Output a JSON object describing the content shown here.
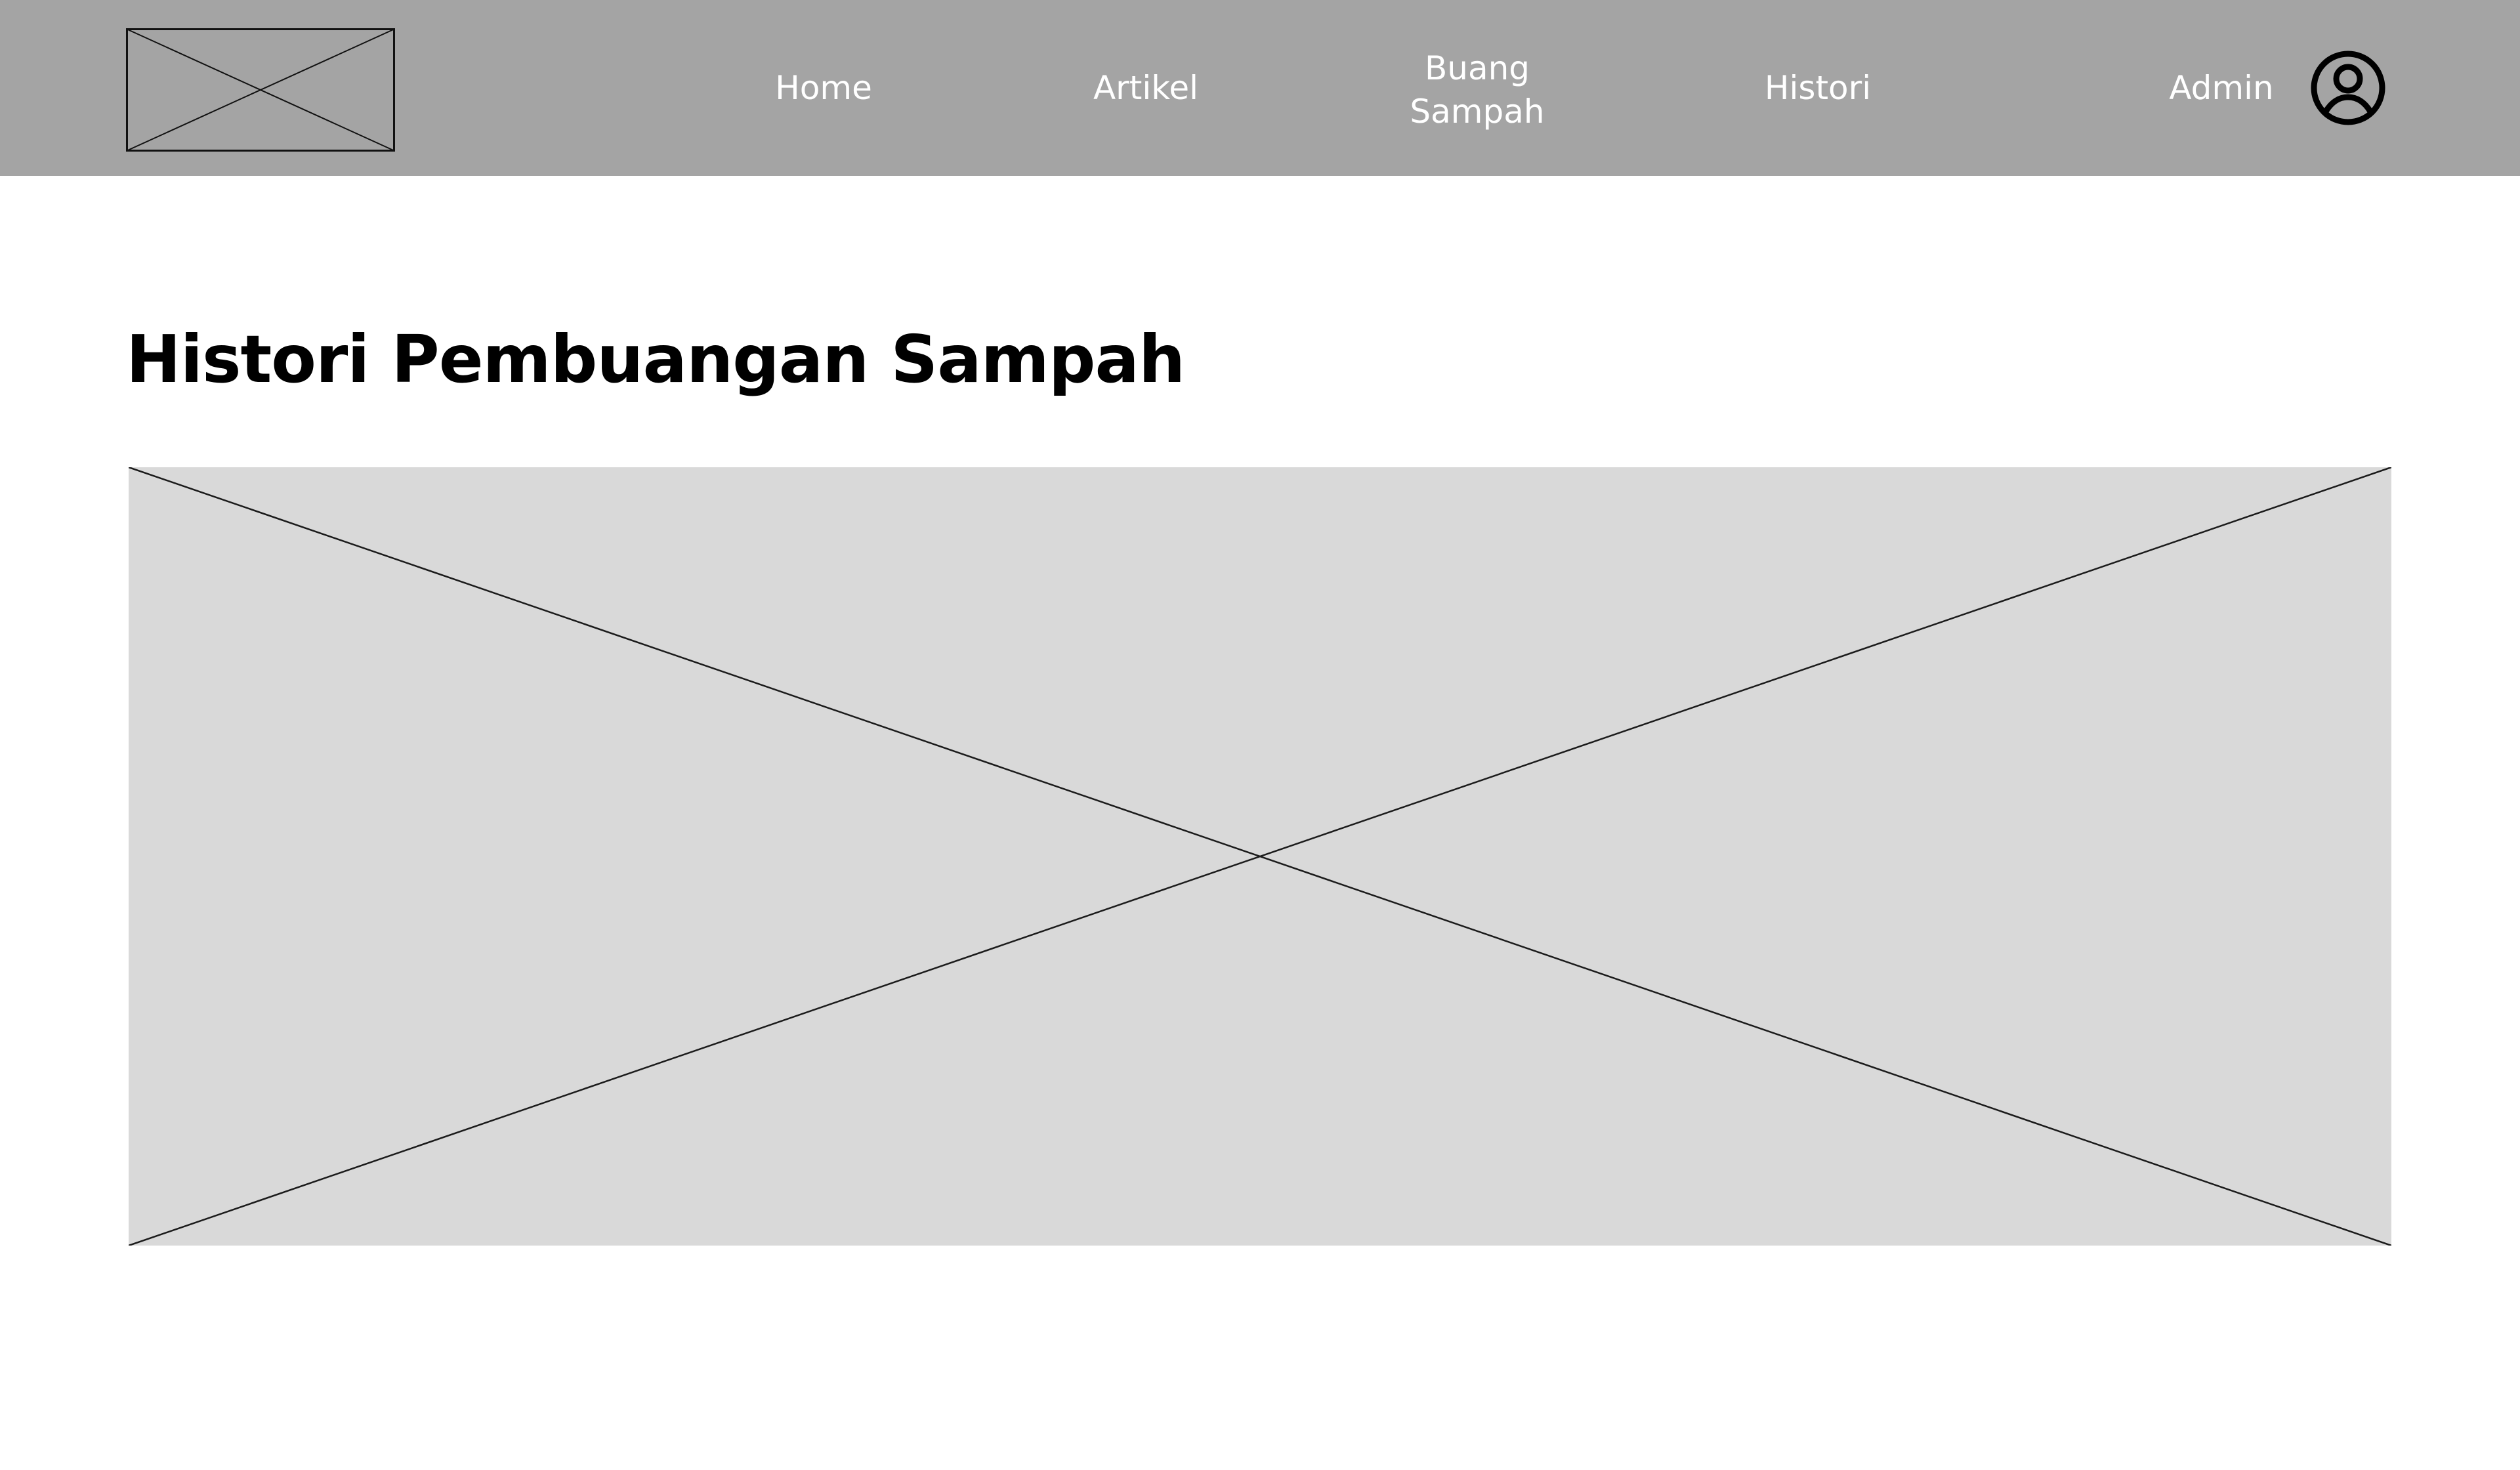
{
  "header": {
    "nav_items": [
      {
        "label": "Home"
      },
      {
        "label": "Artikel"
      },
      {
        "label_line1": "Buang",
        "label_line2": "Sampah"
      },
      {
        "label": "Histori"
      }
    ],
    "user_label": "Admin",
    "user_icon": "user-circle-icon",
    "background_color": "#a4a4a4",
    "text_color": "#ffffff"
  },
  "main": {
    "title": "Histori Pembuangan Sampah",
    "image_placeholder_color": "#d9d9d9"
  }
}
